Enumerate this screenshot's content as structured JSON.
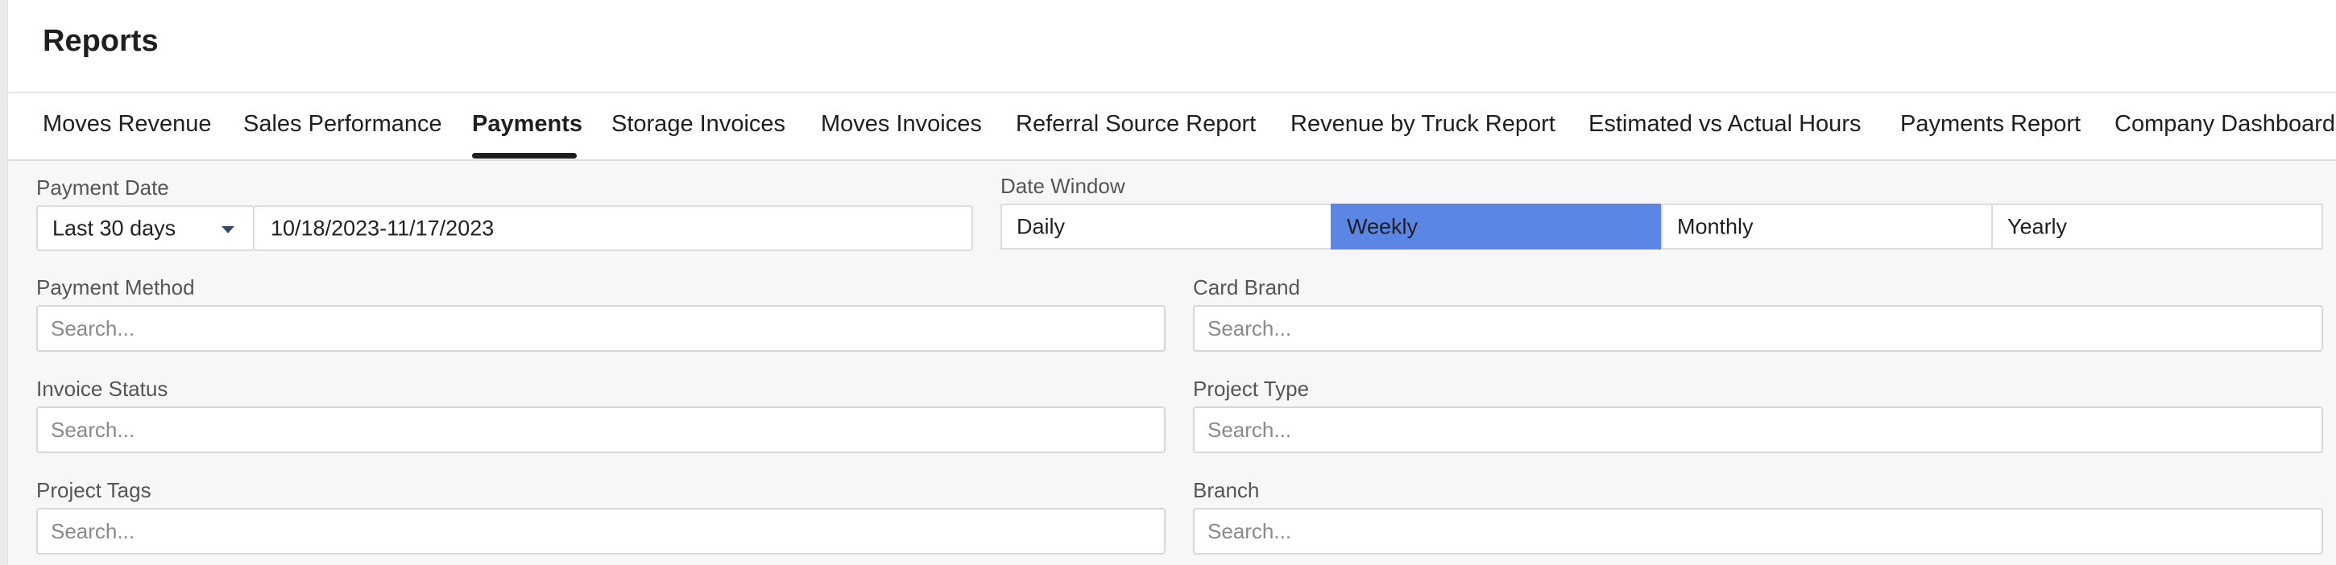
{
  "page": {
    "title": "Reports"
  },
  "tabs": [
    {
      "label": "Moves Revenue",
      "active": false
    },
    {
      "label": "Sales Performance",
      "active": false
    },
    {
      "label": "Payments",
      "active": true
    },
    {
      "label": "Storage Invoices",
      "active": false
    },
    {
      "label": "Moves Invoices",
      "active": false
    },
    {
      "label": "Referral Source Report",
      "active": false
    },
    {
      "label": "Revenue by Truck Report",
      "active": false
    },
    {
      "label": "Estimated vs Actual Hours",
      "active": false
    },
    {
      "label": "Payments Report",
      "active": false
    },
    {
      "label": "Company Dashboard",
      "active": false
    }
  ],
  "filters": {
    "payment_date": {
      "label": "Payment Date",
      "range_option": "Last 30 days",
      "value": "10/18/2023-11/17/2023"
    },
    "date_window": {
      "label": "Date Window",
      "options": [
        "Daily",
        "Weekly",
        "Monthly",
        "Yearly"
      ],
      "selected": "Weekly"
    },
    "payment_method": {
      "label": "Payment Method",
      "placeholder": "Search..."
    },
    "card_brand": {
      "label": "Card Brand",
      "placeholder": "Search..."
    },
    "invoice_status": {
      "label": "Invoice Status",
      "placeholder": "Search..."
    },
    "project_type": {
      "label": "Project Type",
      "placeholder": "Search..."
    },
    "project_tags": {
      "label": "Project Tags",
      "placeholder": "Search..."
    },
    "branch": {
      "label": "Branch",
      "placeholder": "Search..."
    }
  },
  "colors": {
    "active_segment": "#5b86e5",
    "background": "#f7f7f7"
  },
  "icons": {
    "range_dropdown": "caret-down-icon"
  }
}
